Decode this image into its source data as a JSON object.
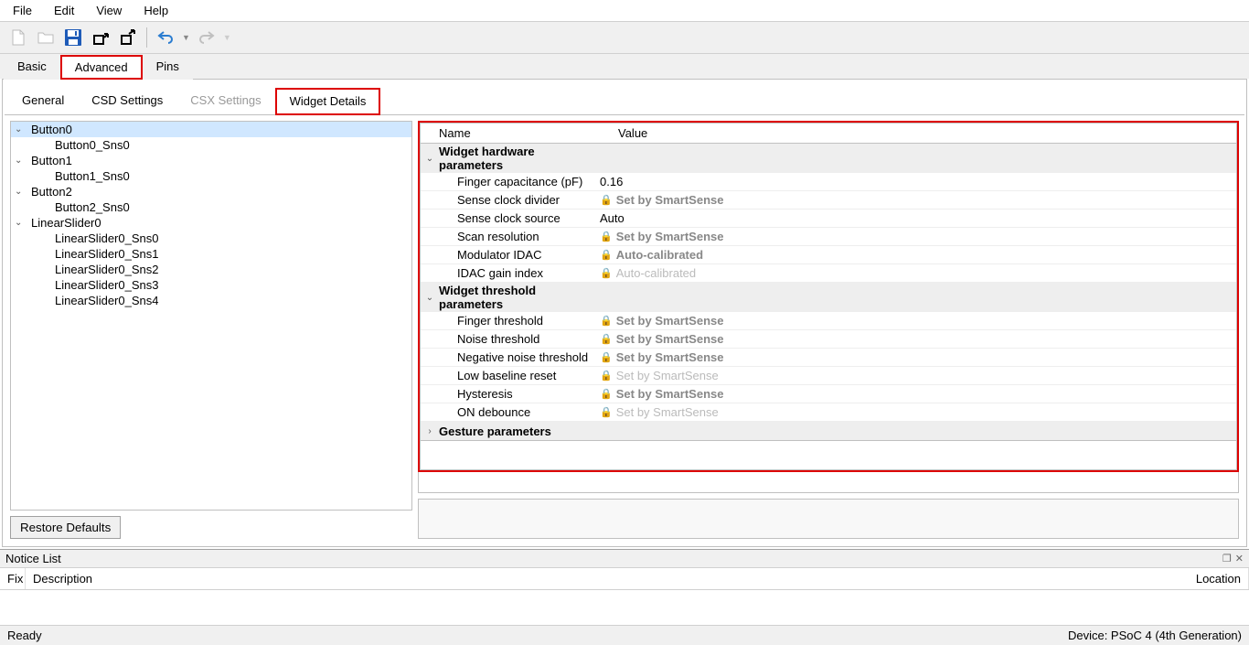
{
  "menubar": [
    "File",
    "Edit",
    "View",
    "Help"
  ],
  "tabs": {
    "basic": "Basic",
    "advanced": "Advanced",
    "pins": "Pins"
  },
  "subtabs": {
    "general": "General",
    "csd": "CSD Settings",
    "csx": "CSX Settings",
    "widget_details": "Widget Details"
  },
  "tree": [
    {
      "label": "Button0",
      "children": [
        "Button0_Sns0"
      ],
      "selected": true
    },
    {
      "label": "Button1",
      "children": [
        "Button1_Sns0"
      ]
    },
    {
      "label": "Button2",
      "children": [
        "Button2_Sns0"
      ]
    },
    {
      "label": "LinearSlider0",
      "children": [
        "LinearSlider0_Sns0",
        "LinearSlider0_Sns1",
        "LinearSlider0_Sns2",
        "LinearSlider0_Sns3",
        "LinearSlider0_Sns4"
      ]
    }
  ],
  "restore_defaults": "Restore Defaults",
  "prop_headers": {
    "name": "Name",
    "value": "Value"
  },
  "prop_groups": [
    {
      "title": "Widget hardware parameters",
      "expanded": true,
      "rows": [
        {
          "name": "Finger capacitance (pF)",
          "value": "0.16",
          "locked": false
        },
        {
          "name": "Sense clock divider",
          "value": "Set by SmartSense",
          "locked": true,
          "bold": true
        },
        {
          "name": "Sense clock source",
          "value": "Auto",
          "locked": false
        },
        {
          "name": "Scan resolution",
          "value": "Set by SmartSense",
          "locked": true,
          "bold": true
        },
        {
          "name": "Modulator IDAC",
          "value": "Auto-calibrated",
          "locked": true,
          "bold": true
        },
        {
          "name": "IDAC gain index",
          "value": "Auto-calibrated",
          "locked": true,
          "bold": false
        }
      ]
    },
    {
      "title": "Widget threshold parameters",
      "expanded": true,
      "rows": [
        {
          "name": "Finger threshold",
          "value": "Set by SmartSense",
          "locked": true,
          "bold": true
        },
        {
          "name": "Noise threshold",
          "value": "Set by SmartSense",
          "locked": true,
          "bold": true
        },
        {
          "name": "Negative noise threshold",
          "value": "Set by SmartSense",
          "locked": true,
          "bold": true
        },
        {
          "name": "Low baseline reset",
          "value": "Set by SmartSense",
          "locked": true,
          "bold": false
        },
        {
          "name": "Hysteresis",
          "value": "Set by SmartSense",
          "locked": true,
          "bold": true
        },
        {
          "name": "ON debounce",
          "value": "Set by SmartSense",
          "locked": true,
          "bold": false
        }
      ]
    },
    {
      "title": "Gesture parameters",
      "expanded": false,
      "rows": []
    }
  ],
  "notice": {
    "title": "Notice List",
    "cols": {
      "fix": "Fix",
      "desc": "Description",
      "loc": "Location"
    }
  },
  "status": {
    "left": "Ready",
    "right": "Device: PSoC 4 (4th Generation)"
  }
}
